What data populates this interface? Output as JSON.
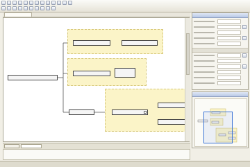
{
  "toolbar": {
    "row1_buttons": [
      "new-icon",
      "open-icon",
      "save-icon",
      "cut-icon",
      "copy-icon",
      "paste-icon",
      "undo-icon",
      "redo-icon",
      "find-icon",
      "zoom-icon",
      "validate-icon",
      "settings-icon",
      "help-icon"
    ],
    "row2_buttons": [
      "schema-icon",
      "element-icon",
      "attribute-icon",
      "sequence-icon",
      "choice-icon",
      "group-icon",
      "complex-type-icon",
      "simple-type-icon",
      "extension-icon",
      "annotation-icon"
    ]
  },
  "colors": {
    "group_fill": "#fbf4c8",
    "node_border": "#444444",
    "selection": "#3b74d6"
  },
  "diagram": {
    "root": {
      "label": "",
      "icon": "element-icon"
    },
    "groups": [
      {
        "title": "",
        "nodes": [
          ""
        ]
      },
      {
        "title": "",
        "nodes": [
          ""
        ]
      },
      {
        "title": "",
        "nodes": [
          "",
          ""
        ]
      }
    ],
    "leaves": [
      "",
      "",
      "",
      ""
    ]
  },
  "bottom_tabs": [
    "",
    ""
  ],
  "properties_panel": {
    "title": ""
  },
  "overview_panel": {
    "title": ""
  }
}
